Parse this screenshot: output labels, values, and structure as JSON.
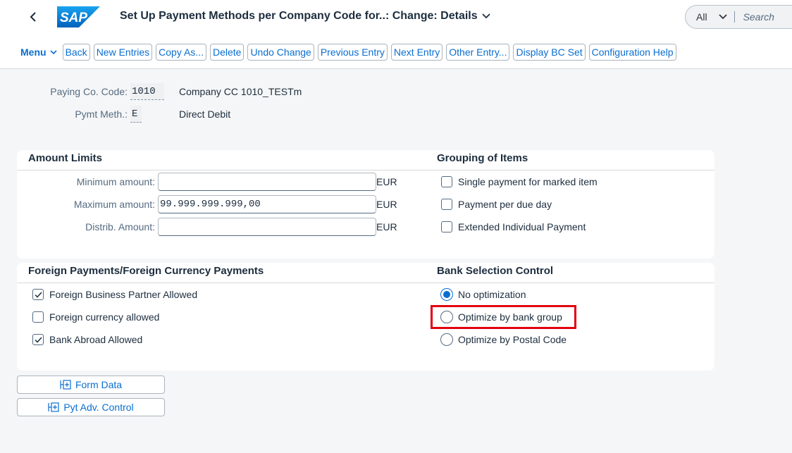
{
  "header": {
    "title": "Set Up Payment Methods per Company Code for..: Change: Details",
    "search_scope": "All",
    "search_placeholder": "Search",
    "logo_text": "SAP"
  },
  "toolbar": {
    "menu_label": "Menu",
    "buttons": [
      "Back",
      "New Entries",
      "Copy As...",
      "Delete",
      "Undo Change",
      "Previous Entry",
      "Next Entry",
      "Other Entry...",
      "Display BC Set",
      "Configuration Help"
    ]
  },
  "key_fields": {
    "paying_co_code_label": "Paying Co. Code:",
    "paying_co_code_value": "1010",
    "company_name": "Company CC 1010_TESTm",
    "pymt_meth_label": "Pymt Meth.:",
    "pymt_meth_value": "E",
    "pymt_meth_desc": "Direct Debit"
  },
  "amount_limits": {
    "title": "Amount Limits",
    "min_label": "Minimum amount:",
    "min_value": "",
    "max_label": "Maximum amount:",
    "max_value": "99.999.999.999,00",
    "distrib_label": "Distrib. Amount:",
    "distrib_value": "",
    "currency": "EUR"
  },
  "grouping": {
    "title": "Grouping of Items",
    "items": [
      {
        "label": "Single payment for marked item",
        "checked": false
      },
      {
        "label": "Payment per due day",
        "checked": false
      },
      {
        "label": "Extended Individual Payment",
        "checked": false
      }
    ]
  },
  "foreign_payments": {
    "title": "Foreign Payments/Foreign Currency Payments",
    "items": [
      {
        "label": "Foreign Business Partner Allowed",
        "checked": true
      },
      {
        "label": "Foreign currency allowed",
        "checked": false
      },
      {
        "label": "Bank Abroad Allowed",
        "checked": true
      }
    ]
  },
  "bank_selection": {
    "title": "Bank Selection Control",
    "options": [
      {
        "label": "No optimization",
        "selected": true
      },
      {
        "label": "Optimize by bank group",
        "selected": false
      },
      {
        "label": "Optimize by Postal Code",
        "selected": false
      }
    ]
  },
  "bottom_buttons": {
    "form_data": "Form Data",
    "pyt_adv_control": "Pyt Adv. Control"
  },
  "colors": {
    "accent": "#0a6ed1",
    "highlight": "#e3000f"
  }
}
